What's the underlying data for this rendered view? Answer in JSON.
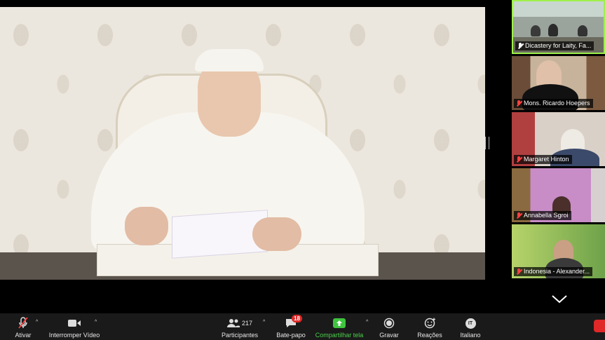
{
  "meeting": {
    "participants": [
      {
        "name": "Dicastery for Laity, Fa...",
        "muted": false,
        "active": true
      },
      {
        "name": "Mons. Ricardo Hoepers",
        "muted": true
      },
      {
        "name": "Margaret Hinton",
        "muted": true
      },
      {
        "name": "Annabella Sgroi",
        "muted": true
      },
      {
        "name": "Indonesia - Alexander...",
        "muted": true
      }
    ]
  },
  "toolbar": {
    "mute_label": "Ativar",
    "video_label": "Interromper Vídeo",
    "participants_label": "Participantes",
    "participants_count": "217",
    "chat_label": "Bate-papo",
    "chat_badge": "18",
    "share_label": "Compartilhar tela",
    "record_label": "Gravar",
    "reactions_label": "Reações",
    "language_label": "Italiano",
    "language_code": "IT"
  },
  "colors": {
    "active_speaker_border": "#9ef04a",
    "share_green": "#4ad04a",
    "muted_red": "#ff4040",
    "badge_red": "#e02828"
  }
}
